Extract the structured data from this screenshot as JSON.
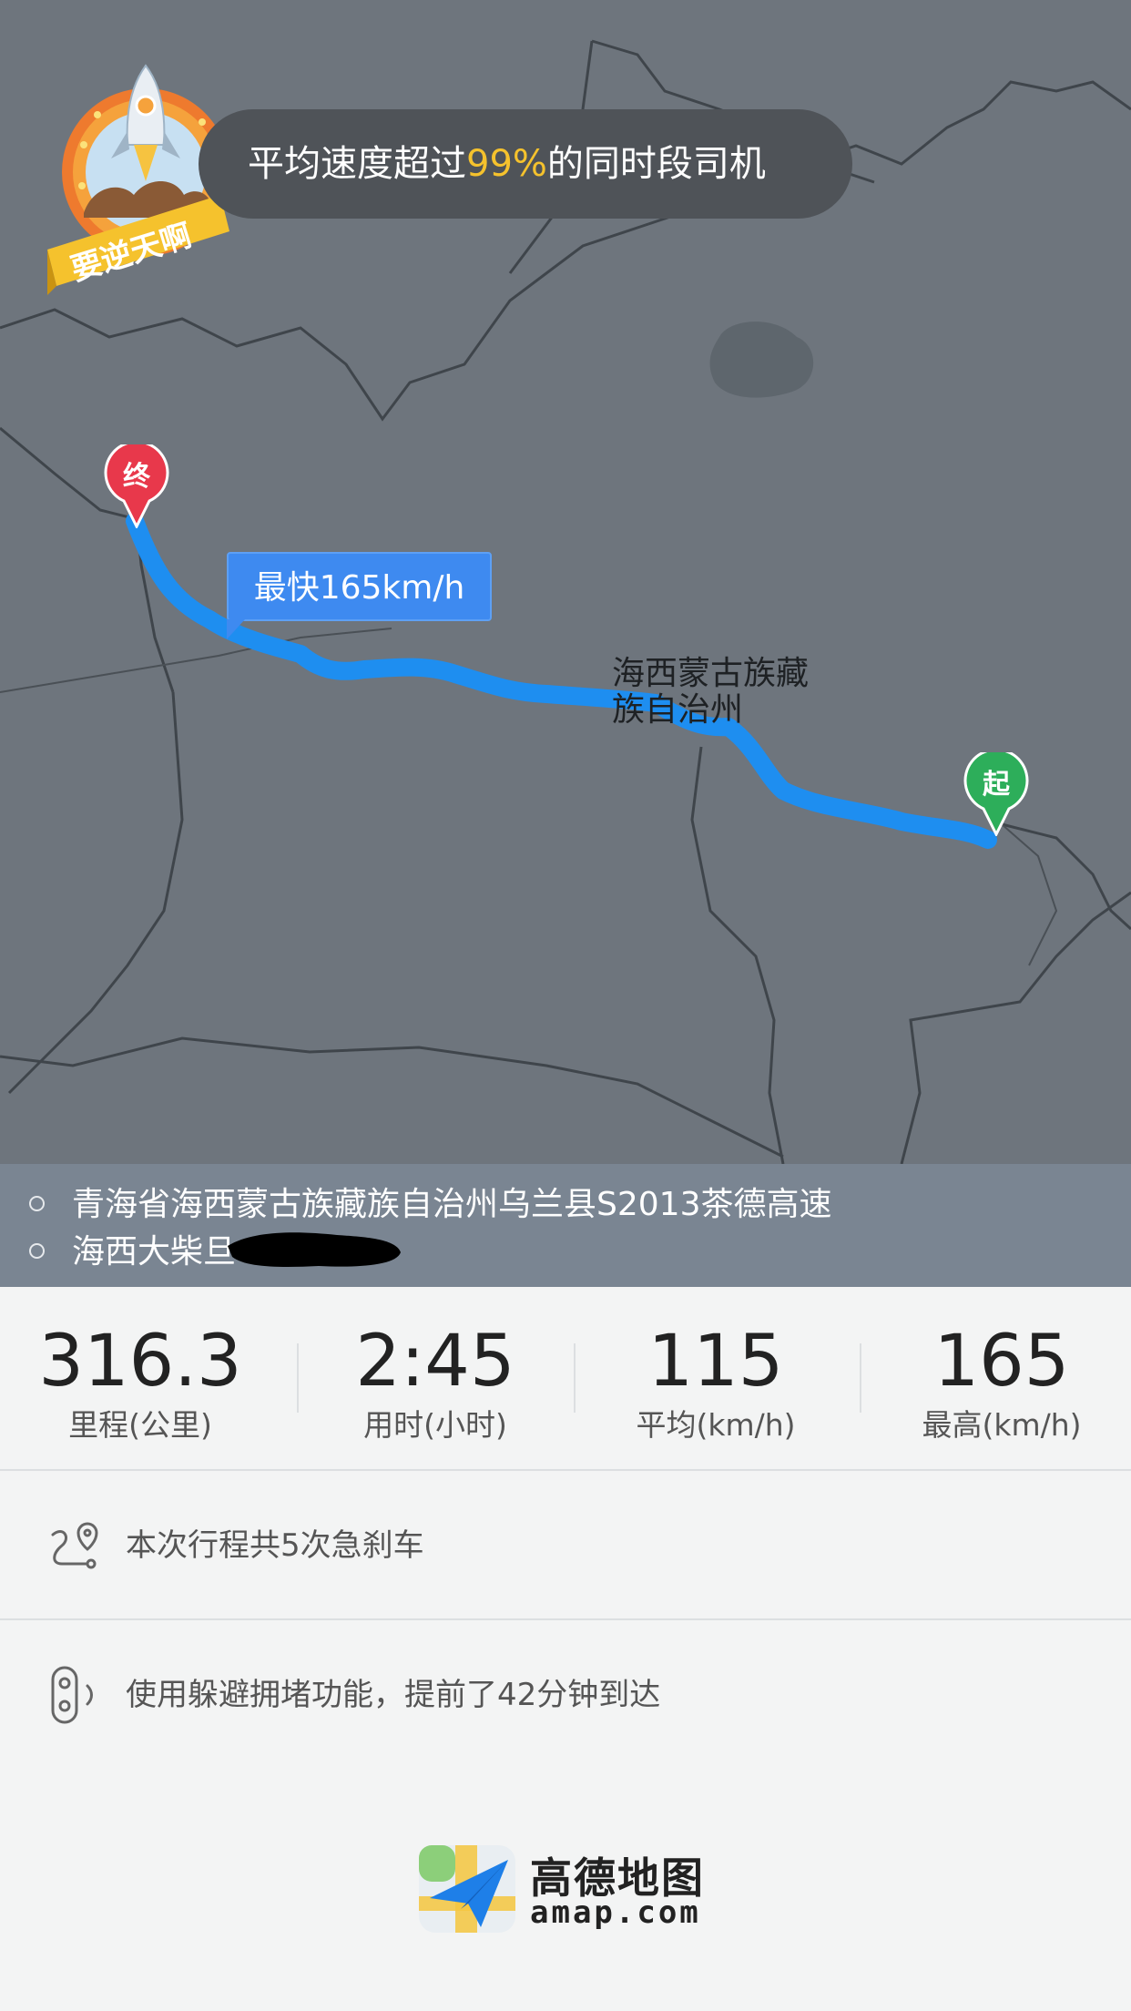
{
  "badge": {
    "ribbon_text": "要逆天啊"
  },
  "speed_banner": {
    "prefix": "平均速度超过",
    "highlight": "99%",
    "suffix": "的同时段司机",
    "highlight_color": "#f5c22d"
  },
  "map": {
    "end_marker": "终",
    "start_marker": "起",
    "max_speed_tip": "最快165km/h",
    "region_label": "海西蒙古族藏族自治州",
    "route_color": "#1e8ef0"
  },
  "addresses": [
    {
      "text": "青海省海西蒙古族藏族自治州乌兰县S2013茶德高速"
    },
    {
      "text": "海西大柴旦"
    }
  ],
  "stats": [
    {
      "value": "316.3",
      "label": "里程(公里)"
    },
    {
      "value": "2:45",
      "label": "用时(小时)"
    },
    {
      "value": "115",
      "label": "平均(km/h)"
    },
    {
      "value": "165",
      "label": "最高(km/h)"
    }
  ],
  "info": {
    "brake": {
      "icon": "route-pin-icon",
      "text": "本次行程共5次急刹车"
    },
    "traffic": {
      "icon": "traffic-light-icon",
      "text": "使用躲避拥堵功能，提前了42分钟到达"
    }
  },
  "footer": {
    "brand_cn": "高德地图",
    "brand_en": "amap.com"
  }
}
